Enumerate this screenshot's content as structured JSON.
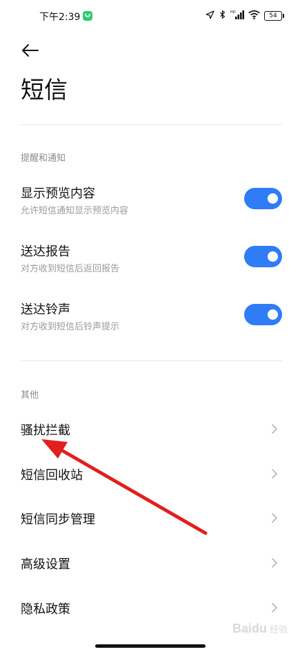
{
  "status_bar": {
    "time": "下午2:39",
    "signal_label": "HD",
    "battery": "54"
  },
  "header": {
    "title": "短信"
  },
  "sections": {
    "notify": {
      "header": "提醒和通知",
      "items": [
        {
          "title": "显示预览内容",
          "subtitle": "允许短信通知显示预览内容",
          "enabled": true
        },
        {
          "title": "送达报告",
          "subtitle": "对方收到短信后返回报告",
          "enabled": true
        },
        {
          "title": "送达铃声",
          "subtitle": "对方收到短信后铃声提示",
          "enabled": true
        }
      ]
    },
    "other": {
      "header": "其他",
      "items": [
        {
          "label": "骚扰拦截"
        },
        {
          "label": "短信回收站"
        },
        {
          "label": "短信同步管理"
        },
        {
          "label": "高级设置"
        },
        {
          "label": "隐私政策"
        }
      ]
    }
  },
  "annotation": {
    "color": "#e02020"
  },
  "watermark": {
    "brand": "Baidu",
    "sub": "经验"
  },
  "colors": {
    "toggle_on": "#2f7cf6",
    "section_header": "#8a8a8a",
    "subtitle": "#9a9a9a"
  }
}
